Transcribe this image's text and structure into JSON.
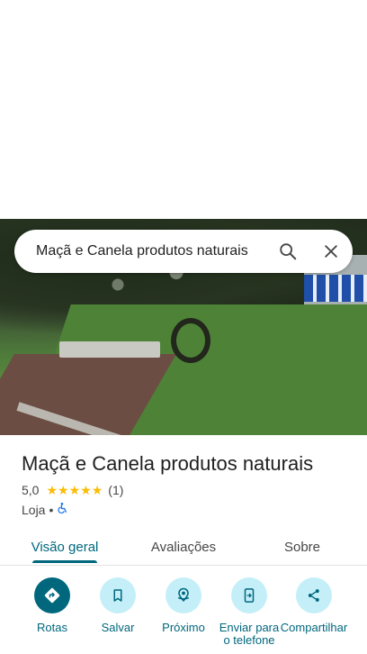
{
  "search": {
    "query": "Maçã e Canela produtos naturais"
  },
  "place": {
    "name": "Maçã e Canela produtos naturais",
    "rating": "5,0",
    "stars": 5,
    "review_count": "(1)",
    "category": "Loja",
    "separator": "•"
  },
  "tabs": [
    {
      "label": "Visão geral",
      "active": true
    },
    {
      "label": "Avaliações",
      "active": false
    },
    {
      "label": "Sobre",
      "active": false
    }
  ],
  "actions": [
    {
      "label": "Rotas",
      "icon": "directions-icon"
    },
    {
      "label": "Salvar",
      "icon": "bookmark-icon"
    },
    {
      "label": "Próximo",
      "icon": "nearby-icon"
    },
    {
      "label": "Enviar para o telefone",
      "icon": "send-to-phone-icon"
    },
    {
      "label": "Compartilhar",
      "icon": "share-icon"
    }
  ],
  "colors": {
    "accent": "#00677d",
    "action_bg": "#c4eff9",
    "star": "#fbbc04",
    "accessibility": "#1a73e8"
  }
}
